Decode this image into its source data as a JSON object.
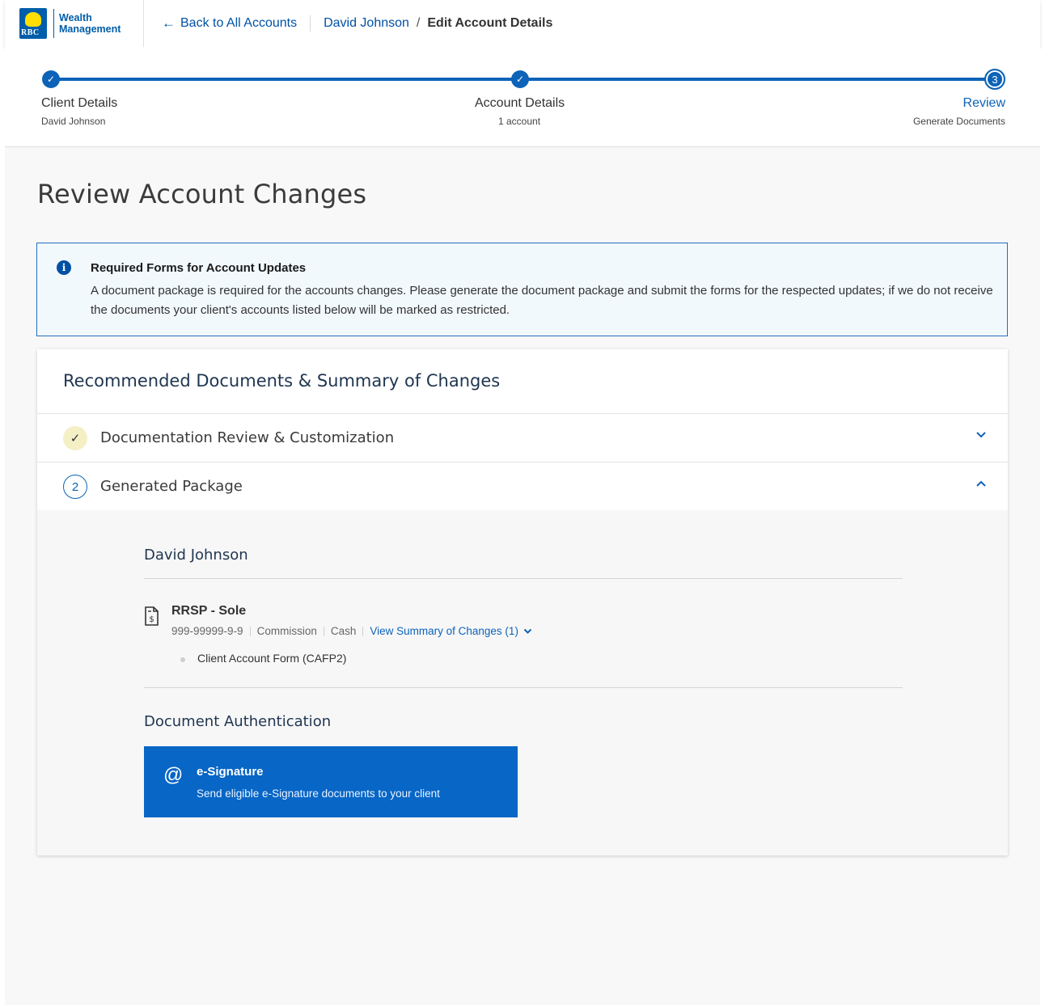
{
  "header": {
    "logo_text_1": "Wealth",
    "logo_text_2": "Management",
    "logo_mark": "RBC",
    "back_label": "Back to All Accounts",
    "breadcrumb_client": "David Johnson",
    "breadcrumb_separator": "/",
    "breadcrumb_current": "Edit Account Details"
  },
  "stepper": {
    "steps": [
      {
        "title": "Client Details",
        "subtitle": "David Johnson",
        "status": "done",
        "marker": "✓"
      },
      {
        "title": "Account Details",
        "subtitle": "1 account",
        "status": "done",
        "marker": "✓"
      },
      {
        "title": "Review",
        "subtitle": "Generate Documents",
        "status": "current",
        "marker": "3"
      }
    ],
    "active_color": "#0d63b8"
  },
  "page": {
    "title": "Review Account Changes"
  },
  "notice": {
    "icon": "info-icon",
    "icon_glyph": "i",
    "title": "Required Forms for Account Updates",
    "body": "A document package is required for the accounts changes. Please generate the document package and submit the forms for the respected updates; if we do not receive the documents your client's accounts listed below will be marked as restricted."
  },
  "card": {
    "title": "Recommended Documents & Summary of Changes",
    "sections": [
      {
        "label": "Documentation Review & Customization",
        "badge": "✓",
        "expanded": false,
        "chevron": "⌄"
      },
      {
        "label": "Generated Package",
        "badge": "2",
        "expanded": true,
        "chevron": "⌃"
      }
    ],
    "package": {
      "client_name": "David Johnson",
      "account": {
        "name": "RRSP - Sole",
        "number": "999-99999-9-9",
        "fee_type": "Commission",
        "account_type": "Cash",
        "summary_link": "View Summary of Changes (1)",
        "summary_chevron": "⌄",
        "forms": [
          "Client Account Form (CAFP2)"
        ]
      },
      "auth_title": "Document Authentication",
      "esignature": {
        "icon_glyph": "@",
        "title": "e-Signature",
        "subtitle": "Send eligible e-Signature documents to your client"
      }
    }
  }
}
